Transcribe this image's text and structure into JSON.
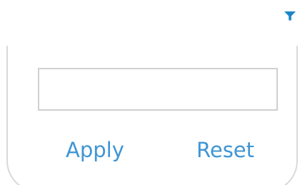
{
  "toolbar": {
    "filter_icon": "filter-icon",
    "accent_color": "#1a86c8"
  },
  "filter_popup": {
    "input_value": "",
    "input_placeholder": "",
    "apply_label": "Apply",
    "reset_label": "Reset",
    "link_color": "#3f95d4"
  }
}
